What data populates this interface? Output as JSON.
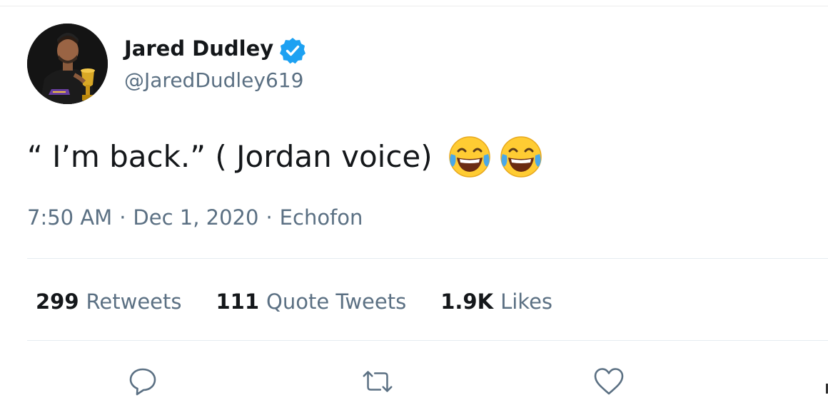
{
  "user": {
    "display_name": "Jared Dudley",
    "handle": "@JaredDudley619",
    "verified": true,
    "avatar_icon": "profile-photo-with-trophy",
    "verified_color": "#1da1f2"
  },
  "tweet": {
    "text": "“ I’m back.” ( Jordan voice)",
    "emojis": [
      "face-with-tears-of-joy-icon",
      "face-with-tears-of-joy-icon"
    ]
  },
  "meta": {
    "time": "7:50 AM",
    "separator": "·",
    "date": "Dec 1, 2020",
    "source": "Echofon"
  },
  "stats": {
    "retweets": {
      "count": "299",
      "label": "Retweets"
    },
    "quotes": {
      "count": "111",
      "label": "Quote Tweets"
    },
    "likes": {
      "count": "1.9K",
      "label": "Likes"
    }
  },
  "actions": {
    "reply_icon": "speech-bubble-icon",
    "retweet_icon": "retweet-arrows-icon",
    "like_icon": "heart-icon",
    "icon_color": "#5b7083"
  }
}
